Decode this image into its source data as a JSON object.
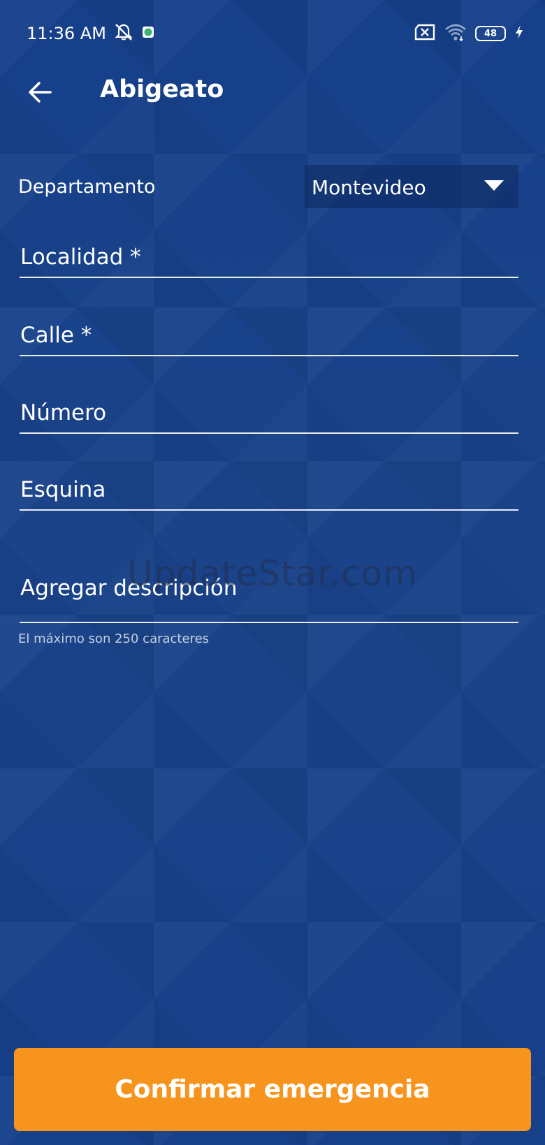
{
  "status_bar": {
    "time": "11:36 AM",
    "battery_level": "48",
    "icons": [
      "mute-bell-icon",
      "app-notification-icon",
      "sim-x-icon",
      "wifi-icon",
      "battery-icon",
      "charging-icon"
    ]
  },
  "app_bar": {
    "title": "Abigeato",
    "back_icon": "arrow-left-icon"
  },
  "form": {
    "departamento_label": "Departamento",
    "departamento_value": "Montevideo",
    "fields": {
      "localidad": "Localidad *",
      "calle": "Calle *",
      "numero": "Número",
      "esquina": "Esquina",
      "descripcion": "Agregar descripción"
    },
    "descripcion_helper": "El máximo son 250 caracteres"
  },
  "watermark": "UpdateStar.com",
  "actions": {
    "confirm_label": "Confirmar emergencia"
  },
  "colors": {
    "background": "#1a4186",
    "accent": "#f7941d",
    "text": "#ffffff"
  }
}
